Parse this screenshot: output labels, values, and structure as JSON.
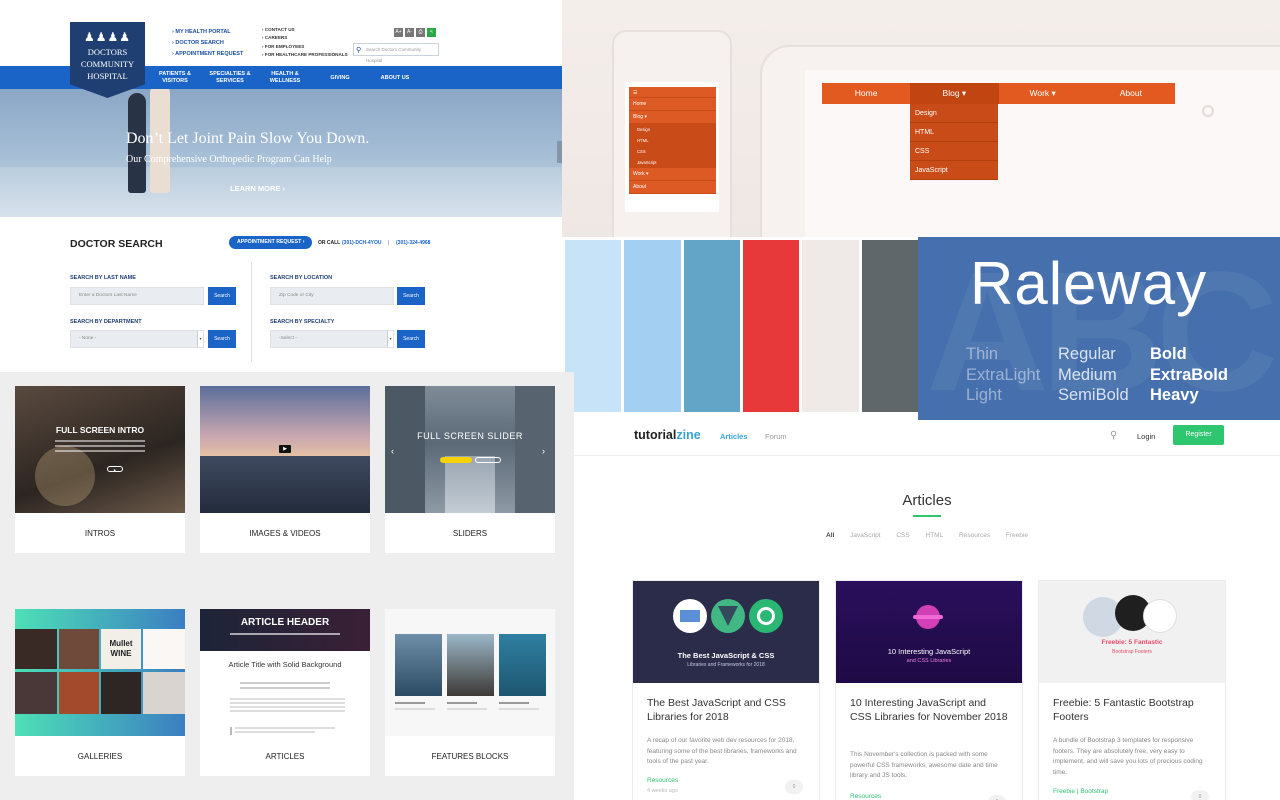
{
  "hospital": {
    "logo": {
      "line1": "DOCTORS",
      "line2": "COMMUNITY",
      "line3": "HOSPITAL",
      "people": "♟♟♟♟"
    },
    "quick_links": [
      "› MY HEALTH PORTAL",
      "› DOCTOR SEARCH",
      "› APPOINTMENT REQUEST"
    ],
    "utility_links": [
      "› CONTACT US",
      "› CAREERS",
      "› FOR EMPLOYEES",
      "› FOR HEALTHCARE PROFESSIONALS"
    ],
    "tools": [
      "A+",
      "A-",
      "⎙",
      "<"
    ],
    "search_placeholder": "Search Doctors Community Hospital",
    "nav": [
      "PATIENTS & VISITORS",
      "SPECIALTIES & SERVICES",
      "HEALTH & WELLNESS",
      "GIVING",
      "ABOUT US"
    ],
    "hero": {
      "title": "Don’t Let Joint Pain Slow You Down.",
      "subtitle": "Our Comprehensive Orthopedic Program Can Help",
      "cta": "LEARN MORE ›"
    },
    "doctor_search": {
      "title": "DOCTOR SEARCH",
      "appointment_button": "APPOINTMENT REQUEST ›",
      "or_call": "OR CALL",
      "phone1": "(301)-DCH-4YOU",
      "separator": "|",
      "phone2": "(301)-324-4968",
      "last_name_label": "SEARCH BY LAST NAME",
      "last_name_placeholder": "Enter a Doctors Last Name",
      "location_label": "SEARCH BY LOCATION",
      "location_placeholder": "Zip Code or City",
      "department_label": "SEARCH BY DEPARTMENT",
      "department_value": "- None -",
      "specialty_label": "SEARCH BY SPECIALTY",
      "specialty_value": "-Select -",
      "search_button": "Search"
    }
  },
  "dropdown_mockup": {
    "mobile_toggle": "☰",
    "mobile_items": [
      "Home",
      "Blog ▾",
      "Design",
      "HTML",
      "CSS",
      "JavaScript",
      "Work ▾",
      "About"
    ],
    "desktop_items": [
      "Home",
      "Blog ▾",
      "Work ▾",
      "About"
    ],
    "desktop_dropdown": [
      "Design",
      "HTML",
      "CSS",
      "JavaScript"
    ]
  },
  "palette": {
    "colors": [
      "#c6e3f8",
      "#a2cff2",
      "#62a5c7",
      "#e8393a",
      "#efe9e8",
      "#5f676a"
    ]
  },
  "raleway": {
    "title": "Raleway",
    "background_letters": "ABC",
    "weights_col1": [
      "Thin",
      "ExtraLight",
      "Light"
    ],
    "weights_col2": [
      "Regular",
      "Medium",
      "SemiBold"
    ],
    "weights_col3": [
      "Bold",
      "ExtraBold",
      "Heavy"
    ]
  },
  "blocks": {
    "intro_thumb": {
      "title": "FULL SCREEN INTRO",
      "button": "▶"
    },
    "slider_thumb": {
      "title": "FULL SCREEN SLIDER",
      "prev": "‹",
      "next": "›"
    },
    "article_thumb": {
      "header": "ARTICLE HEADER",
      "article_title": "Article Title with Solid Background"
    },
    "video_play": "▶",
    "gallery_text": "Mullet WINE",
    "items": [
      "INTROS",
      "IMAGES & VIDEOS",
      "SLIDERS",
      "GALLERIES",
      "ARTICLES",
      "FEATURES BLOCKS"
    ]
  },
  "tutorialzine": {
    "logo_a": "tutorial",
    "logo_b": "zine",
    "nav_active": "Articles",
    "nav_other": "Forum",
    "search_icon": "⚲",
    "login": "Login",
    "register": "Register",
    "page_title": "Articles",
    "filters": [
      "All",
      "JavaScript",
      "CSS",
      "HTML",
      "Resources",
      "Freebie"
    ],
    "cards": [
      {
        "image_line1": "The Best JavaScript & CSS",
        "image_line2": "Libraries and Frameworks for 2018",
        "title": "The Best JavaScript and CSS Libraries for 2018",
        "description": "A recap of our favorite web dev resources for 2018, featuring some of the best libraries, frameworks and tools of the past year.",
        "tag": "Resources",
        "age": "4 weeks ago",
        "comments": "0"
      },
      {
        "image_line1": "10 Interesting JavaScript",
        "image_line2": "and CSS Libraries",
        "title": "10 Interesting JavaScript and CSS Libraries for November 2018",
        "description": "This November's collection is packed with some powerful CSS frameworks, awesome date and time library and JS tools.",
        "tag": "Resources",
        "comments": "0"
      },
      {
        "image_line1": "Freebie: 5 Fantastic",
        "image_line2": "Bootstrap Footers",
        "title": "Freebie: 5 Fantastic Bootstrap Footers",
        "description": "A bundle of Bootstrap 3 templates for responsive footers. They are absolutely free, very easy to implement, and will save you lots of precious coding time.",
        "tag": "Freebie | Bootstrap",
        "comments": "0"
      }
    ]
  }
}
